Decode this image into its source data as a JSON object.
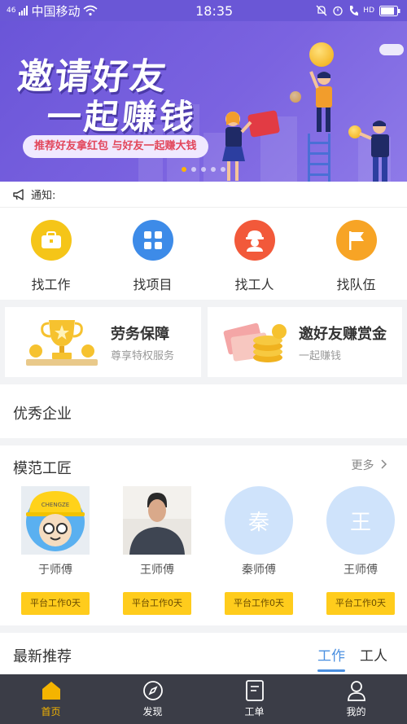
{
  "status_bar": {
    "carrier": "中国移动",
    "time": "18:35",
    "signal_prefix": "46",
    "hd_label": "HD"
  },
  "banner": {
    "title_line1": "邀请好友",
    "title_line2": "一起赚钱",
    "pill_text": "推荐好友拿红包 与好友一起赚大钱",
    "dots_count": 5,
    "active_dot": 0
  },
  "notice": {
    "label": "通知:"
  },
  "quick_menu": [
    {
      "label": "找工作",
      "icon": "briefcase-icon",
      "color": "#f5c518"
    },
    {
      "label": "找项目",
      "icon": "grid-icon",
      "color": "#3d8be8"
    },
    {
      "label": "找工人",
      "icon": "worker-icon",
      "color": "#f2593a"
    },
    {
      "label": "找队伍",
      "icon": "flag-icon",
      "color": "#f7a425"
    }
  ],
  "promos": [
    {
      "title": "劳务保障",
      "subtitle": "尊享特权服务",
      "icon": "trophy-icon"
    },
    {
      "title": "邀好友赚赏金",
      "subtitle": "一起赚钱",
      "icon": "coins-icon"
    }
  ],
  "sections": {
    "companies": {
      "title": "优秀企业"
    },
    "craftsmen": {
      "title": "模范工匠",
      "more_label": "更多",
      "workers": [
        {
          "name": "于师傅",
          "tag": "平台工作0天",
          "avatar": "cartoon-photo",
          "cap_text": "CHENGZE"
        },
        {
          "name": "王师傅",
          "tag": "平台工作0天",
          "avatar": "photo"
        },
        {
          "name": "秦师傅",
          "tag": "平台工作0天",
          "avatar": "initial",
          "initial": "秦"
        },
        {
          "name": "王师傅",
          "tag": "平台工作0天",
          "avatar": "initial",
          "initial": "王"
        }
      ]
    },
    "latest": {
      "title": "最新推荐",
      "tabs": [
        {
          "label": "工作",
          "active": true
        },
        {
          "label": "工人",
          "active": false
        }
      ]
    }
  },
  "bottom_nav": [
    {
      "label": "首页",
      "icon": "home-icon",
      "active": true
    },
    {
      "label": "发现",
      "icon": "compass-icon",
      "active": false
    },
    {
      "label": "工单",
      "icon": "document-icon",
      "active": false
    },
    {
      "label": "我的",
      "icon": "user-icon",
      "active": false
    }
  ],
  "colors": {
    "banner_purple": "#6a55d8",
    "accent_yellow": "#ffcc1c",
    "tab_blue": "#4a8fe0",
    "nav_bg": "#3b3d47",
    "nav_active": "#f4b400"
  }
}
